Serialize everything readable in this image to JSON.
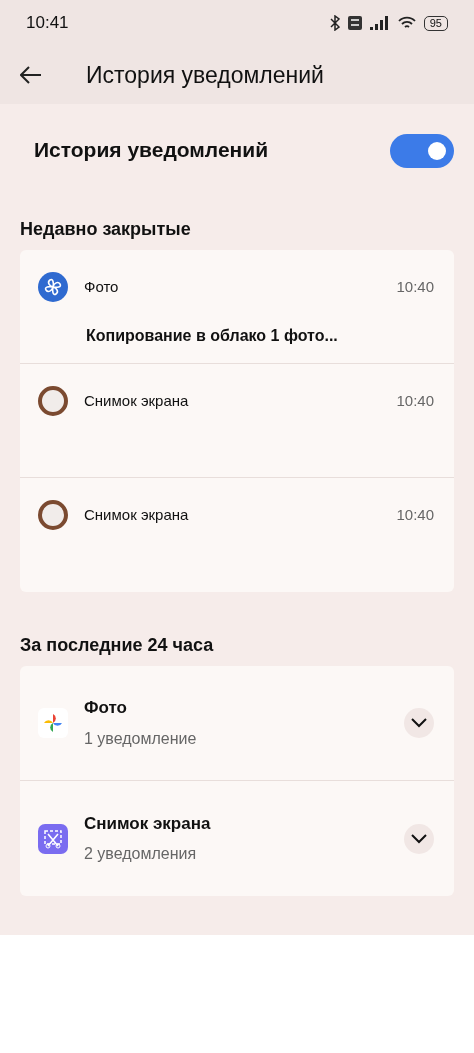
{
  "status_bar": {
    "time": "10:41",
    "battery": "95"
  },
  "header": {
    "title": "История уведомлений"
  },
  "master_toggle": {
    "label": "История уведомлений",
    "on": true
  },
  "recent": {
    "title": "Недавно закрытые",
    "items": [
      {
        "kind": "pinwheel",
        "app": "Фото",
        "time": "10:40",
        "text": "Копирование в облако 1 фото..."
      },
      {
        "kind": "square",
        "app": "Снимок экрана",
        "time": "10:40"
      },
      {
        "kind": "square",
        "app": "Снимок экрана",
        "time": "10:40"
      }
    ]
  },
  "last24": {
    "title": "За последние 24 часа",
    "items": [
      {
        "kind": "photos",
        "app": "Фото",
        "count": "1 уведомление",
        "expanded": false
      },
      {
        "kind": "scissors",
        "app": "Снимок экрана",
        "count": "2 уведомления",
        "expanded": false
      }
    ]
  }
}
